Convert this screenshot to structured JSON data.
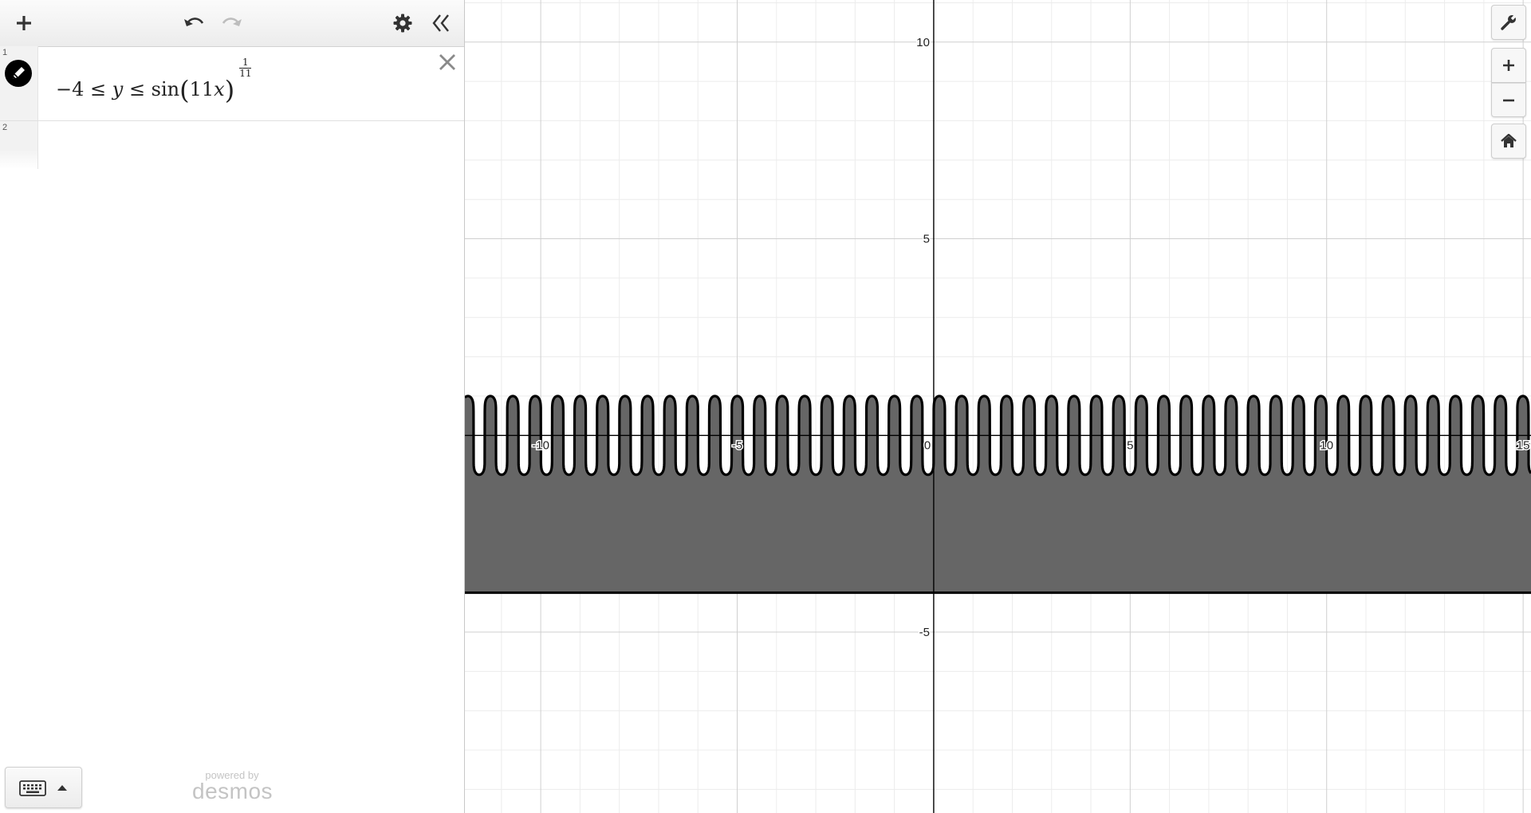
{
  "toolbar": {
    "add_icon": "plus-icon",
    "undo_icon": "undo-icon",
    "redo_icon": "redo-icon",
    "settings_icon": "gear-icon",
    "collapse_icon": "double-chevron-left-icon"
  },
  "expressions": [
    {
      "index": "1",
      "color": "#000000",
      "latex": "-4 \\le y \\le \\sin(11x)^{\\frac{1}{11}}",
      "parts": {
        "lower": "−4 ≤ ",
        "var": "y",
        "rel": " ≤ sin",
        "arg_num": "11",
        "arg_var": "x",
        "exp_num": "1",
        "exp_den": "11"
      }
    },
    {
      "index": "2",
      "latex": ""
    }
  ],
  "footer": {
    "keypad_icon": "keyboard-icon",
    "powered_by": "powered by",
    "logo": "desmos"
  },
  "graph": {
    "x_range": [
      -11.93,
      15.2
    ],
    "y_range": [
      -9.6,
      11.07
    ],
    "major_step": 5,
    "minor_step": 1,
    "x_tick_labels": [
      "-10",
      "-5",
      "0",
      "5",
      "10",
      "15"
    ],
    "y_tick_labels": [
      "10",
      "5",
      "-5"
    ],
    "shading_color": "#666666",
    "curve_color": "#000000"
  },
  "graph_controls": {
    "settings_icon": "wrench-icon",
    "zoom_in_icon": "plus-icon",
    "zoom_out_icon": "minus-icon",
    "home_icon": "home-icon"
  }
}
